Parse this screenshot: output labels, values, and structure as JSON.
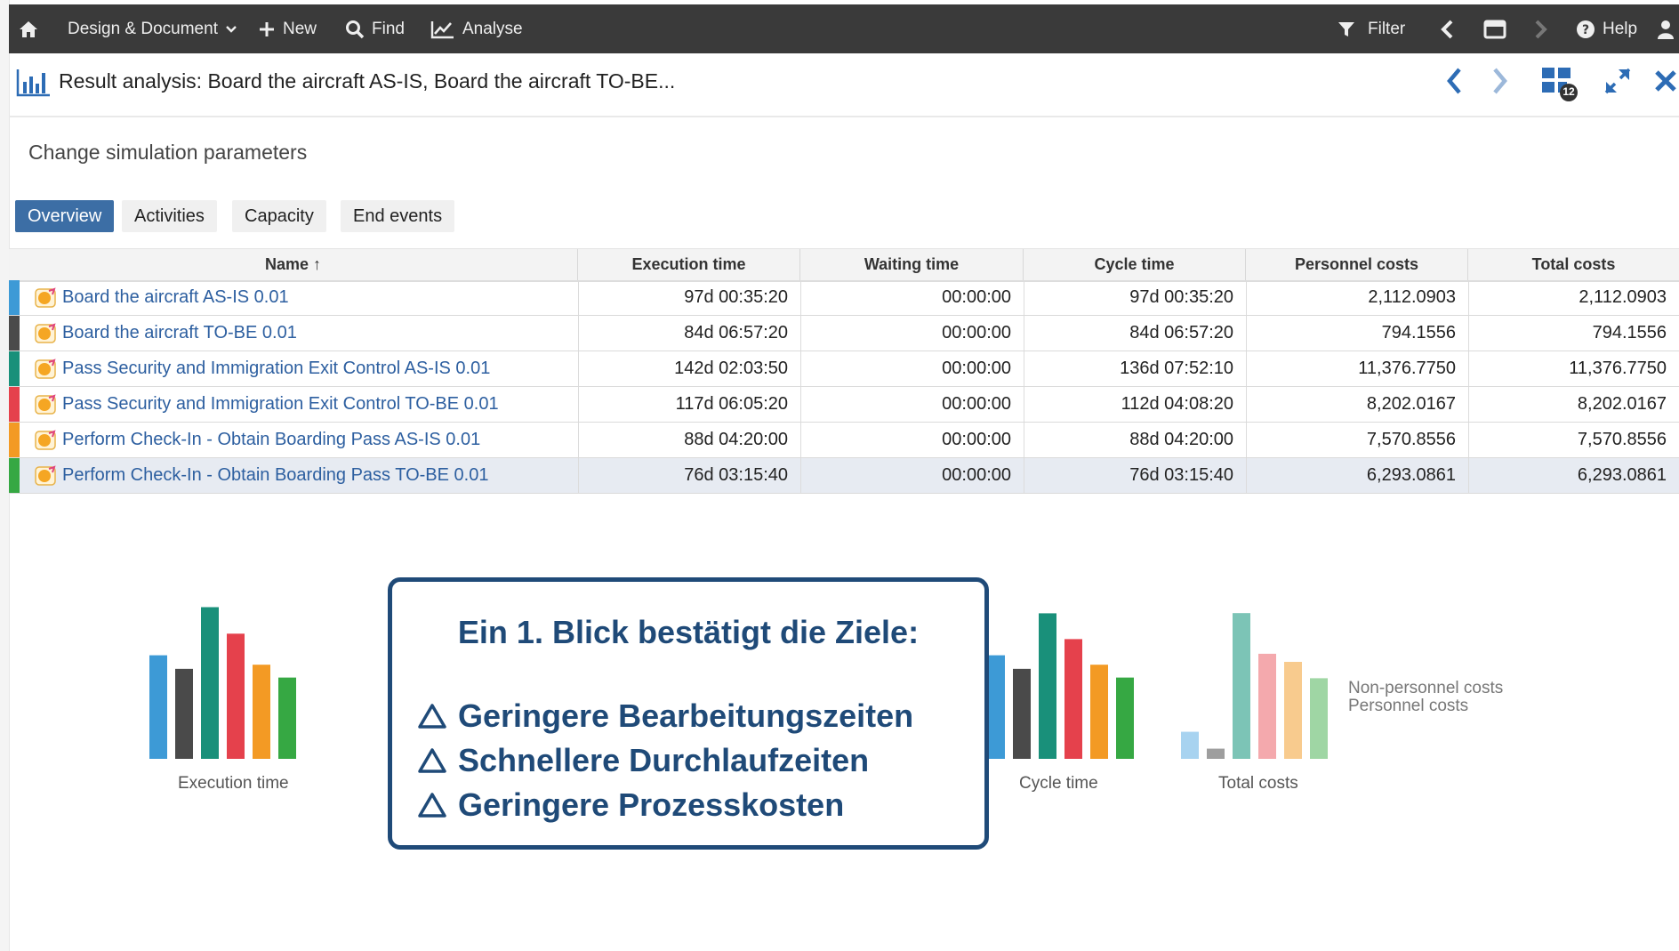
{
  "topbar": {
    "design_label": "Design & Document",
    "new_label": "New",
    "find_label": "Find",
    "analyse_label": "Analyse",
    "filter_label": "Filter",
    "help_label": "Help",
    "icons": [
      "home-icon",
      "chevron-down-icon",
      "plus-icon",
      "search-icon",
      "chart-line-icon",
      "filter-icon",
      "chevron-left-icon",
      "window-icon",
      "chevron-right-icon",
      "help-icon",
      "user-icon"
    ]
  },
  "window": {
    "title": "Result analysis: Board the aircraft AS-IS, Board the aircraft TO-BE...",
    "badge": "12"
  },
  "change_link": "Change simulation parameters",
  "tabs": [
    "Overview",
    "Activities",
    "Capacity",
    "End events"
  ],
  "active_tab": "Overview",
  "table": {
    "headers": [
      "Name ↑",
      "Execution time",
      "Waiting time",
      "Cycle time",
      "Personnel costs",
      "Total costs"
    ],
    "rows": [
      {
        "name": "Board the aircraft AS-IS 0.01",
        "color": "#3d9ad6",
        "exec": "97d 00:35:20",
        "wait": "00:00:00",
        "cycle": "97d 00:35:20",
        "personnel": "2,112.0903",
        "total": "2,112.0903"
      },
      {
        "name": "Board the aircraft TO-BE 0.01",
        "color": "#4a4a4a",
        "exec": "84d 06:57:20",
        "wait": "00:00:00",
        "cycle": "84d 06:57:20",
        "personnel": "794.1556",
        "total": "794.1556"
      },
      {
        "name": "Pass Security and Immigration Exit Control AS-IS 0.01",
        "color": "#19907a",
        "exec": "142d 02:03:50",
        "wait": "00:00:00",
        "cycle": "136d 07:52:10",
        "personnel": "11,376.7750",
        "total": "11,376.7750"
      },
      {
        "name": "Pass Security and Immigration Exit Control TO-BE 0.01",
        "color": "#e5414c",
        "exec": "117d 06:05:20",
        "wait": "00:00:00",
        "cycle": "112d 04:08:20",
        "personnel": "8,202.0167",
        "total": "8,202.0167"
      },
      {
        "name": "Perform Check-In - Obtain Boarding Pass AS-IS 0.01",
        "color": "#f39a24",
        "exec": "88d 04:20:00",
        "wait": "00:00:00",
        "cycle": "88d 04:20:00",
        "personnel": "7,570.8556",
        "total": "7,570.8556"
      },
      {
        "name": "Perform Check-In - Obtain Boarding Pass TO-BE 0.01",
        "color": "#36a843",
        "exec": "76d 03:15:40",
        "wait": "00:00:00",
        "cycle": "76d 03:15:40",
        "personnel": "6,293.0861",
        "total": "6,293.0861"
      }
    ],
    "selected_row": 5
  },
  "charts": {
    "execution_title": "Execution time",
    "cycle_title": "Cycle time",
    "total_title": "Total costs",
    "legend": [
      "Non-personnel costs",
      "Personnel costs"
    ]
  },
  "chart_data": [
    {
      "type": "bar",
      "title": "Execution time",
      "categories": [
        "Board the aircraft AS-IS 0.01",
        "Board the aircraft TO-BE 0.01",
        "Pass Security and Immigration Exit Control AS-IS 0.01",
        "Pass Security and Immigration Exit Control TO-BE 0.01",
        "Perform Check-In - Obtain Boarding Pass AS-IS 0.01",
        "Perform Check-In - Obtain Boarding Pass TO-BE 0.01"
      ],
      "values": [
        97.02,
        84.29,
        142.09,
        117.25,
        88.18,
        76.14
      ],
      "colors": [
        "#3d9ad6",
        "#4a4a4a",
        "#19907a",
        "#e5414c",
        "#f39a24",
        "#36a843"
      ],
      "ylim": [
        0,
        150
      ]
    },
    {
      "type": "bar",
      "title": "Cycle time",
      "categories": [
        "Board the aircraft AS-IS 0.01",
        "Board the aircraft TO-BE 0.01",
        "Pass Security and Immigration Exit Control AS-IS 0.01",
        "Pass Security and Immigration Exit Control TO-BE 0.01",
        "Perform Check-In - Obtain Boarding Pass AS-IS 0.01",
        "Perform Check-In - Obtain Boarding Pass TO-BE 0.01"
      ],
      "values": [
        97.02,
        84.29,
        136.33,
        112.17,
        88.18,
        76.14
      ],
      "colors": [
        "#3d9ad6",
        "#4a4a4a",
        "#19907a",
        "#e5414c",
        "#f39a24",
        "#36a843"
      ],
      "ylim": [
        0,
        150
      ]
    },
    {
      "type": "bar",
      "title": "Total costs",
      "categories": [
        "Board the aircraft AS-IS 0.01",
        "Board the aircraft TO-BE 0.01",
        "Pass Security and Immigration Exit Control AS-IS 0.01",
        "Pass Security and Immigration Exit Control TO-BE 0.01",
        "Perform Check-In - Obtain Boarding Pass AS-IS 0.01",
        "Perform Check-In - Obtain Boarding Pass TO-BE 0.01"
      ],
      "values": [
        2112.0903,
        794.1556,
        11376.775,
        8202.0167,
        7570.8556,
        6293.0861
      ],
      "colors": [
        "#a8d3f0",
        "#9e9e9e",
        "#7cc4b6",
        "#f4a9ad",
        "#f8cb8e",
        "#9fd6a4"
      ],
      "legend": [
        "Non-personnel costs",
        "Personnel costs"
      ],
      "ylim": [
        0,
        12500
      ]
    }
  ],
  "callout": {
    "title": "Ein 1. Blick bestätigt die Ziele:",
    "bullets": [
      "Geringere Bearbeitungszeiten",
      "Schnellere Durchlaufzeiten",
      "Geringere Prozesskosten"
    ],
    "bullet_icon": "triangle-outline-icon"
  }
}
